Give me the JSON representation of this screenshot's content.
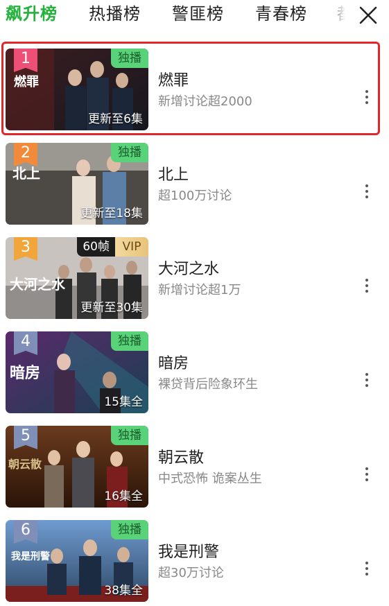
{
  "tabs": [
    "飙升榜",
    "热播榜",
    "警匪榜",
    "青春榜",
    "都"
  ],
  "close_icon": "close-icon",
  "items": [
    {
      "rank": "1",
      "rank_color": "#ee4f77",
      "badge": "独播",
      "episodes": "更新至6集",
      "title": "燃罪",
      "subtitle": "新增讨论超2000",
      "poster_text": "燃罪",
      "selected": true
    },
    {
      "rank": "2",
      "rank_color": "#f28a3b",
      "badge": "独播",
      "episodes": "更新至18集",
      "title": "北上",
      "subtitle": "超100万讨论",
      "poster_text": "北上"
    },
    {
      "rank": "3",
      "rank_color": "#f2a53a",
      "badge_60": "60帧",
      "badge_vip": "VIP",
      "episodes": "更新至30集",
      "title": "大河之水",
      "subtitle": "新增讨论超1万",
      "poster_text": "大河之水"
    },
    {
      "rank": "4",
      "rank_color": "#7f8fb8",
      "badge": "独播",
      "episodes": "15集全",
      "title": "暗房",
      "subtitle": "裸贷背后险象环生",
      "poster_text": "暗房"
    },
    {
      "rank": "5",
      "rank_color": "#7f8fb8",
      "badge": "独播",
      "episodes": "16集全",
      "title": "朝云散",
      "subtitle": "中式恐怖 诡案丛生",
      "poster_text": "朝云散"
    },
    {
      "rank": "6",
      "rank_color": "#7f8fb8",
      "badge": "独播",
      "episodes": "38集全",
      "title": "我是刑警",
      "subtitle": "超30万讨论",
      "poster_text": "我是刑警"
    }
  ],
  "more_icon": "more-vertical-icon"
}
